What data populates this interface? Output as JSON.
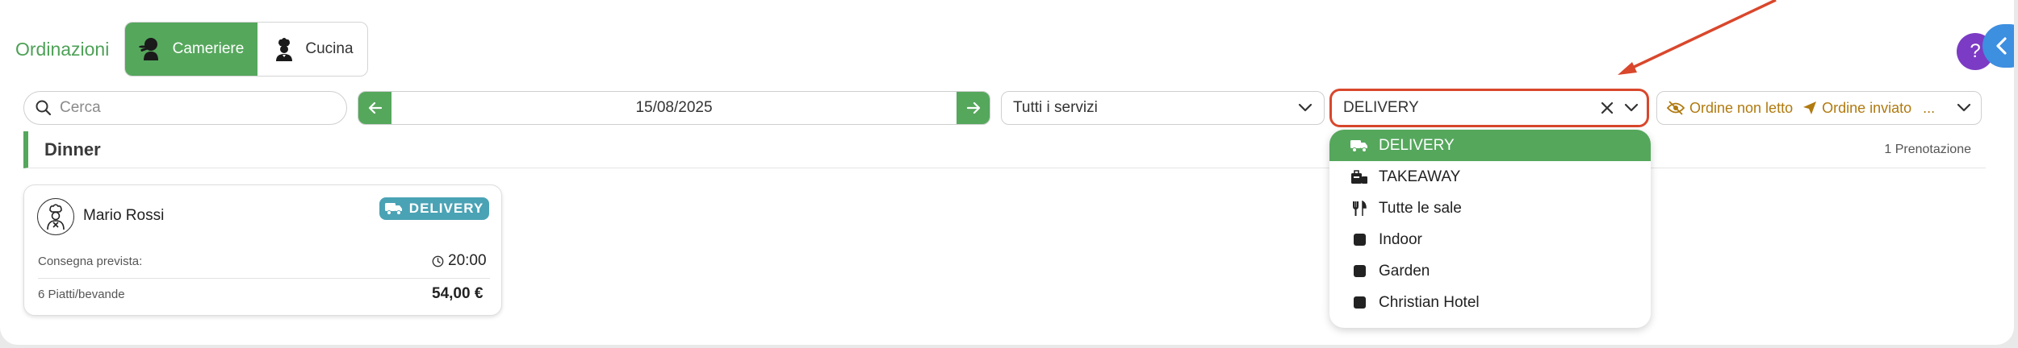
{
  "header": {
    "title": "Ordinazioni",
    "tabs": [
      {
        "label": "Cameriere",
        "icon": "waiter-icon",
        "active": true
      },
      {
        "label": "Cucina",
        "icon": "chef-icon",
        "active": false
      }
    ],
    "help_label": "?"
  },
  "filters": {
    "search_placeholder": "Cerca",
    "date": "15/08/2025",
    "services_value": "Tutti i servizi",
    "type_value": "DELIVERY",
    "status_unread": "Ordine non letto",
    "status_sent": "Ordine inviato",
    "status_more": "..."
  },
  "section": {
    "title": "Dinner",
    "count_label": "1 Prenotazione"
  },
  "order_card": {
    "customer": "Mario Rossi",
    "badge": "DELIVERY",
    "delivery_label": "Consegna prevista:",
    "delivery_time": "20:00",
    "items_label": "6 Piatti/bevande",
    "total": "54,00 €"
  },
  "dropdown": {
    "items": [
      {
        "label": "DELIVERY",
        "icon": "truck-icon",
        "selected": true
      },
      {
        "label": "TAKEAWAY",
        "icon": "takeaway-icon",
        "selected": false
      },
      {
        "label": "Tutte le sale",
        "icon": "cutlery-icon",
        "selected": false
      },
      {
        "label": "Indoor",
        "icon": "square-icon",
        "selected": false
      },
      {
        "label": "Garden",
        "icon": "square-icon",
        "selected": false
      },
      {
        "label": "Christian Hotel",
        "icon": "square-icon",
        "selected": false
      }
    ]
  },
  "colors": {
    "accent_green": "#55a75c",
    "highlight_red": "#d9472c",
    "badge_teal": "#4aa3b5",
    "status_gold": "#b07a10",
    "help_purple": "#7c3bc4",
    "tab_blue": "#3d8fe0"
  }
}
